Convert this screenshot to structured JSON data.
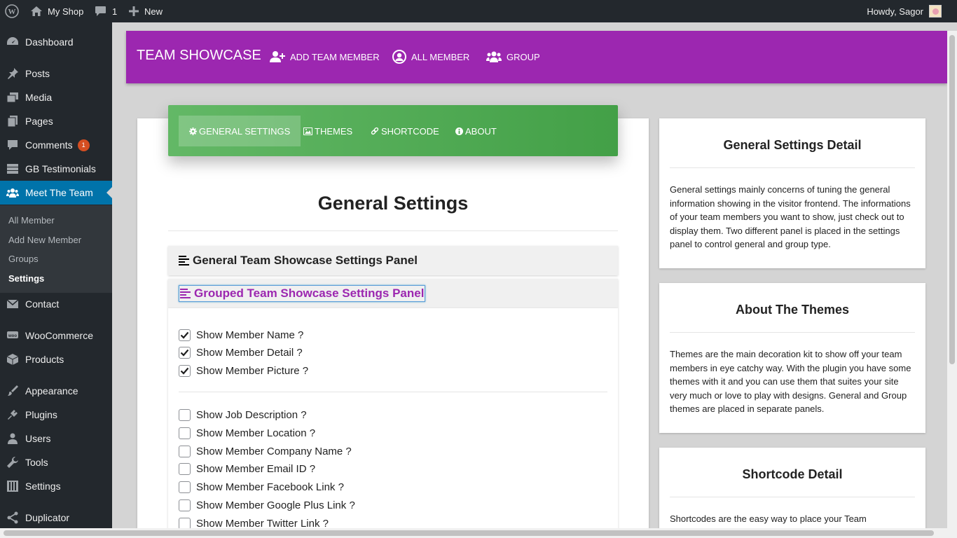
{
  "adminbar": {
    "site_name": "My Shop",
    "comments_count": "1",
    "new_label": "New",
    "greeting": "Howdy, Sagor"
  },
  "sidebar": {
    "items": [
      {
        "label": "Dashboard",
        "icon": "dashboard-icon"
      },
      {
        "label": "Posts",
        "icon": "pin-icon"
      },
      {
        "label": "Media",
        "icon": "media-icon"
      },
      {
        "label": "Pages",
        "icon": "pages-icon"
      },
      {
        "label": "Comments",
        "icon": "comment-icon",
        "badge": "1"
      },
      {
        "label": "GB Testimonials",
        "icon": "list-icon"
      },
      {
        "label": "Meet The Team",
        "icon": "team-icon"
      },
      {
        "label": "Contact",
        "icon": "mail-icon"
      },
      {
        "label": "WooCommerce",
        "icon": "woo-icon"
      },
      {
        "label": "Products",
        "icon": "box-icon"
      },
      {
        "label": "Appearance",
        "icon": "brush-icon"
      },
      {
        "label": "Plugins",
        "icon": "plug-icon"
      },
      {
        "label": "Users",
        "icon": "user-icon"
      },
      {
        "label": "Tools",
        "icon": "wrench-icon"
      },
      {
        "label": "Settings",
        "icon": "sliders-icon"
      },
      {
        "label": "Duplicator",
        "icon": "share-icon"
      }
    ],
    "submenu": [
      "All Member",
      "Add New Member",
      "Groups",
      "Settings"
    ],
    "active_item": "Meet The Team",
    "active_submenu": "Settings"
  },
  "header": {
    "brand": "TEAM SHOWCASE",
    "links": [
      "ADD TEAM MEMBER",
      "ALL MEMBER",
      "GROUP"
    ],
    "color": "#9c27b0"
  },
  "tabs": {
    "items": [
      "GENERAL SETTINGS",
      "THEMES",
      "SHORTCODE",
      "ABOUT"
    ],
    "active": "GENERAL SETTINGS",
    "color": "#43a047"
  },
  "main": {
    "title": "General Settings",
    "panel1_title": "General Team Showcase Settings Panel",
    "panel2_title": "Grouped Team Showcase Settings Panel",
    "checked_options": [
      "Show Member Name ?",
      "Show Member Detail ?",
      "Show Member Picture ?"
    ],
    "unchecked_options": [
      "Show Job Description ?",
      "Show Member Location ?",
      "Show Member Company Name ?",
      "Show Member Email ID ?",
      "Show Member Facebook Link ?",
      "Show Member Google Plus Link ?",
      "Show Member Twitter Link ?"
    ]
  },
  "right_cards": [
    {
      "title": "General Settings Detail",
      "text": "General settings mainly concerns of tuning the general information showing in the visitor frontend. The informations of your team members you want to show, just check out to display them. Two different panel is placed in the settings panel to control general and group type."
    },
    {
      "title": "About The Themes",
      "text": "Themes are the main decoration kit to show off your team members in eye catchy way. With the plugin you have some themes with it and you can use them that suites your site very much or love to play with designs. General and Group themes are placed in separate panels."
    },
    {
      "title": "Shortcode Detail",
      "text": "Shortcodes are the easy way to place your Team"
    }
  ]
}
